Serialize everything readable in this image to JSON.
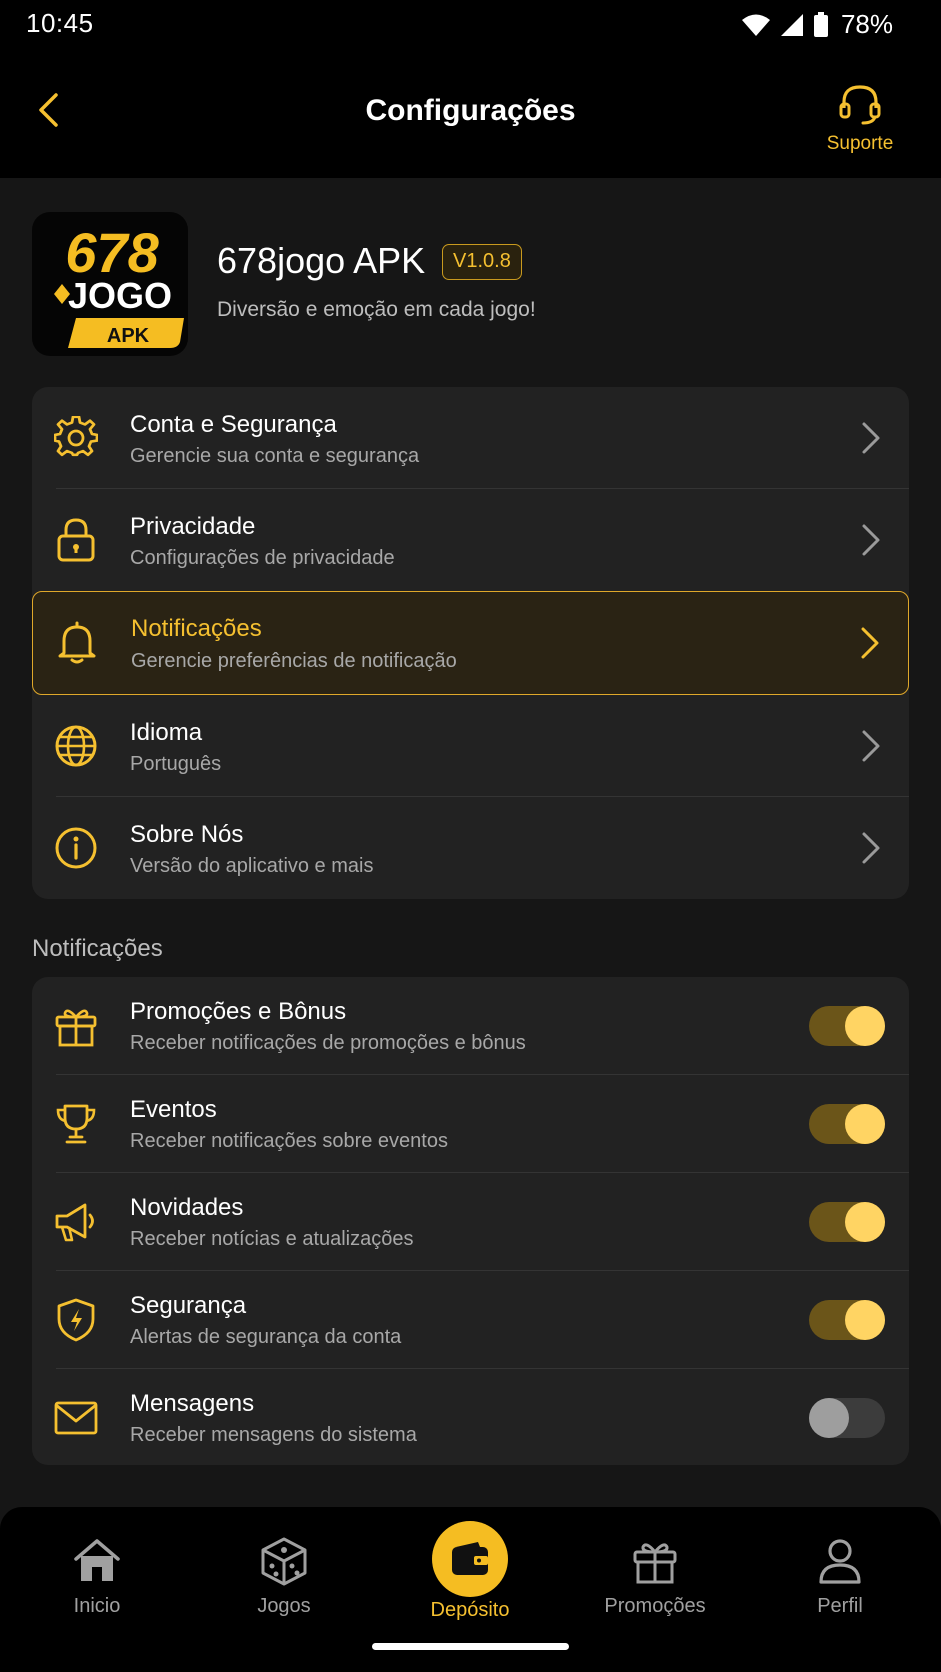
{
  "status_bar": {
    "time": "10:45",
    "battery": "78%"
  },
  "header": {
    "title": "Configurações",
    "support_label": "Suporte"
  },
  "app": {
    "name": "678jogo APK",
    "version": "V1.0.8",
    "tagline": "Diversão e emoção em cada jogo!",
    "logo": {
      "line1": "678",
      "line2": "JOGO",
      "line3": "APK"
    }
  },
  "settings": [
    {
      "title": "Conta e Segurança",
      "subtitle": "Gerencie sua conta e segurança",
      "icon": "gear-icon"
    },
    {
      "title": "Privacidade",
      "subtitle": "Configurações de privacidade",
      "icon": "lock-icon"
    },
    {
      "title": "Notificações",
      "subtitle": "Gerencie preferências de notificação",
      "icon": "bell-icon",
      "active": true
    },
    {
      "title": "Idioma",
      "subtitle": "Português",
      "icon": "globe-icon"
    },
    {
      "title": "Sobre Nós",
      "subtitle": "Versão do aplicativo e mais",
      "icon": "info-icon"
    }
  ],
  "notifications_section": {
    "title": "Notificações",
    "items": [
      {
        "title": "Promoções e Bônus",
        "subtitle": "Receber notificações de promoções e bônus",
        "icon": "gift-icon",
        "enabled": true
      },
      {
        "title": "Eventos",
        "subtitle": "Receber notificações sobre eventos",
        "icon": "trophy-icon",
        "enabled": true
      },
      {
        "title": "Novidades",
        "subtitle": "Receber notícias e atualizações",
        "icon": "megaphone-icon",
        "enabled": true
      },
      {
        "title": "Segurança",
        "subtitle": "Alertas de segurança da conta",
        "icon": "shield-icon",
        "enabled": true
      },
      {
        "title": "Mensagens",
        "subtitle": "Receber mensagens do sistema",
        "icon": "mail-icon",
        "enabled": false
      }
    ]
  },
  "bottom_nav": [
    {
      "label": "Inicio",
      "icon": "home-icon"
    },
    {
      "label": "Jogos",
      "icon": "dice-icon"
    },
    {
      "label": "Depósito",
      "icon": "wallet-icon",
      "active": true
    },
    {
      "label": "Promoções",
      "icon": "gift-icon"
    },
    {
      "label": "Perfil",
      "icon": "user-icon"
    }
  ],
  "colors": {
    "accent": "#F5C030",
    "background": "#161616",
    "card": "#222222",
    "header": "#000000"
  }
}
